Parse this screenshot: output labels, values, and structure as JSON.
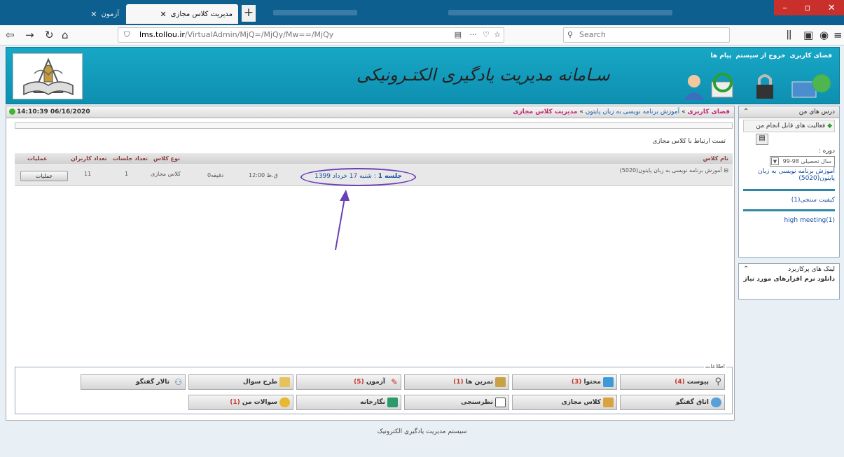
{
  "browser": {
    "tabs": [
      {
        "title": "آزمون",
        "active": false
      },
      {
        "title": "مدیریت کلاس مجازی",
        "active": true
      }
    ],
    "url_host": "lms.tollou.ir",
    "url_path": "/VirtualAdmin/MjQ=/MjQy/Mw==/MjQy",
    "search_placeholder": "Search",
    "page_actions": "···"
  },
  "site": {
    "title": "سـامانه مدیریت یادگیری الکتـرونیکی",
    "top_menu": [
      "فضای کاربری",
      "خروج از سیستم",
      "پیام ها"
    ]
  },
  "breadcrumb": {
    "items": [
      "فضای کاربری",
      "آموزش برنامه نویسی به زبان پایتون",
      "مدیریت کلاس مجازی"
    ],
    "separator": "»",
    "datetime": "14:10:39 06/16/2020"
  },
  "main": {
    "test_link": "تست ارتباط با کلاس مجازی",
    "table_headers": {
      "class_name": "نام کلاس",
      "class_type": "نوع کلاس",
      "session_count": "تعداد جلسات",
      "user_count": "تعداد کاربران",
      "operations": "عملیات"
    },
    "row": {
      "class_name": "آموزش برنامه نویسی به زبان پایتون(5020)",
      "session_label": "جلسه 1",
      "session_date": ": شنبه 17 خرداد 1399",
      "time": "12:00 ق.ظ",
      "duration": "0دقیقه",
      "class_type": "کلاس مجازی",
      "session_count": "1",
      "user_count": "11",
      "ops_button": "عملیات"
    },
    "info_legend": "اطلاعات",
    "buttons_row1": [
      {
        "label": "پیوست",
        "count": "(4)"
      },
      {
        "label": "محتوا",
        "count": "(3)"
      },
      {
        "label": "تمرین ها",
        "count": "(1)"
      },
      {
        "label": "آزمون",
        "count": "(5)"
      },
      {
        "label": "طرح سوال",
        "count": ""
      },
      {
        "label": "تالار گفتگو",
        "count": ""
      }
    ],
    "buttons_row2": [
      {
        "label": "اتاق گفتگو",
        "count": ""
      },
      {
        "label": "کلاس مجازی",
        "count": ""
      },
      {
        "label": "نظرسنجی",
        "count": ""
      },
      {
        "label": "نگارخانه",
        "count": ""
      },
      {
        "label": "سوالات من",
        "count": "(1)"
      }
    ]
  },
  "sidebar": {
    "my_courses_title": "درس های من",
    "activities_label": "فعالیت های قابل انجام من",
    "course_label": "دوره :",
    "year_select": "سال تحصیلی 98-99",
    "course_link": "آموزش برنامه نویسی به زبان پایتون(5020)",
    "quality_link": "کیفیت سنجی(1)",
    "meeting_link": "high meeting(1)",
    "links_title": "لینک های پرکاربرد",
    "download_link": "دانلود نرم افزارهای مورد نیاز"
  },
  "footer": "سیستم مدیریت یادگیری الکترونیک"
}
